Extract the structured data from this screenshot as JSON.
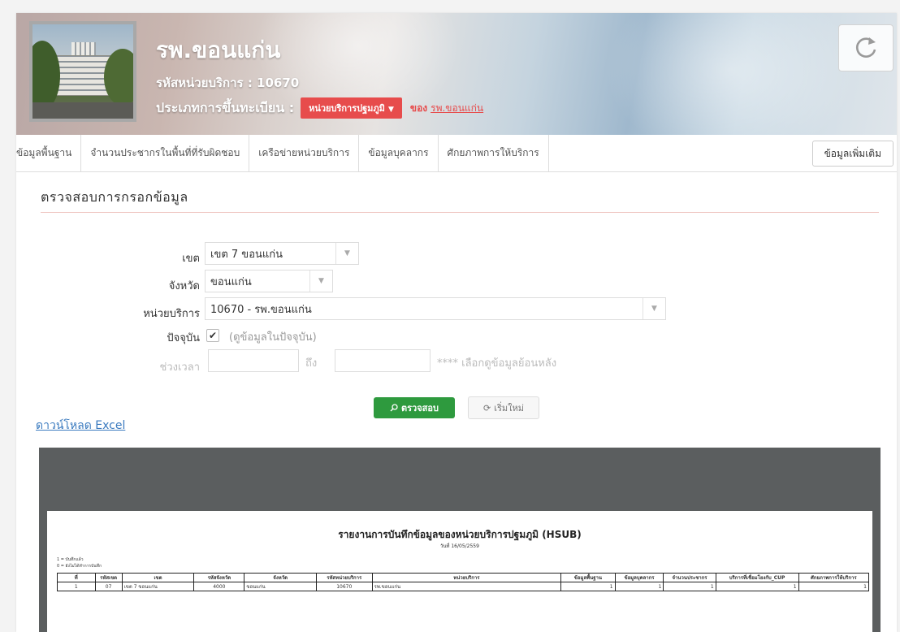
{
  "header": {
    "hospital_name": "รพ.ขอนแก่น",
    "unit_code": "รหัสหน่วยบริการ : 10670",
    "registration_label": "ประเภทการขึ้นทะเบียน :",
    "registration_type": "หน่วยบริการปฐมภูมิ",
    "of_label": "ของ",
    "parent_link": "รพ.ขอนแก่น",
    "refresh_icon": "refresh-icon",
    "accent_color": "#e74c4c"
  },
  "nav": {
    "items": [
      "ข้อมูลพื้นฐาน",
      "จำนวนประชากรในพื้นที่ที่รับผิดชอบ",
      "เครือข่ายหน่วยบริการ",
      "ข้อมูลบุคลากร",
      "ศักยภาพการให้บริการ"
    ],
    "more_label": "ข้อมูลเพิ่มเติม"
  },
  "form": {
    "title": "ตรวจสอบการกรอกข้อมูล",
    "zone_label": "เขต",
    "zone_value": "เขต 7 ขอนแก่น",
    "province_label": "จังหวัด",
    "province_value": "ขอนแก่น",
    "unit_label": "หน่วยบริการ",
    "unit_value": "10670 - รพ.ขอนแก่น",
    "current_label": "ปัจจุบัน",
    "current_checked": true,
    "current_note": "(ดูข้อมูลในปัจจุบัน)",
    "period_label": "ช่วงเวลา",
    "to_label": "ถึง",
    "period_note": "**** เลือกดูข้อมูลย้อนหลัง",
    "check_button": "ตรวจสอบ",
    "reset_button": "เริ่มใหม่",
    "download_link": "ดาวน์โหลด Excel",
    "primary_color": "#2e9a3e"
  },
  "report": {
    "title": "รายงานการบันทึกข้อมูลของหน่วยบริการปฐมภูมิ (HSUB)",
    "date": "วันที่ 16/05/2559",
    "legend_1": "1 = บันทึกแล้ว",
    "legend_0": "0 = ยังไม่ได้ทำการบันทึก",
    "columns": [
      "ที่",
      "รหัสเขต",
      "เขต",
      "รหัสจังหวัด",
      "จังหวัด",
      "รหัสหน่วยบริการ",
      "หน่วยบริการ",
      "ข้อมูลพื้นฐาน",
      "ข้อมูลบุคลากร",
      "จำนวนประชากร",
      "บริการที่เชื่อมโยงกับ_CUP",
      "ศักยภาพการให้บริการ"
    ],
    "rows": [
      [
        "1",
        "07",
        "เขต 7 ขอนแก่น",
        "4000",
        "ขอนแก่น",
        "10670",
        "รพ.ขอนแก่น",
        "1",
        "1",
        "1",
        "1",
        "1"
      ]
    ]
  }
}
